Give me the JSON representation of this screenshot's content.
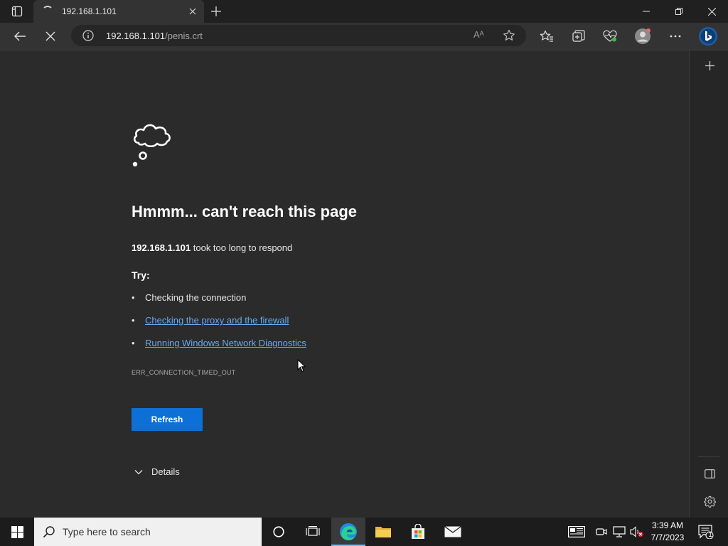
{
  "browser": {
    "tab_title": "192.168.1.101",
    "url_host": "192.168.1.101",
    "url_path": "/penis.crt",
    "read_aloud_label": "Aᴬ"
  },
  "page": {
    "heading": "Hmmm... can't reach this page",
    "host": "192.168.1.101",
    "message": " took too long to respond",
    "try_label": "Try:",
    "suggestions": [
      "Checking the connection",
      "Checking the proxy and the firewall",
      "Running Windows Network Diagnostics"
    ],
    "error_code": "ERR_CONNECTION_TIMED_OUT",
    "refresh_label": "Refresh",
    "details_label": "Details"
  },
  "taskbar": {
    "search_placeholder": "Type here to search",
    "time": "3:39 AM",
    "date": "7/7/2023",
    "notification_count": "1"
  },
  "colors": {
    "accent": "#0c70d6",
    "link": "#69a9ee",
    "page_bg": "#2b2b2b"
  },
  "icons": [
    "tab-actions-icon",
    "loading-spinner-icon",
    "close-icon",
    "plus-icon",
    "minimize-icon",
    "restore-icon",
    "back-arrow-icon",
    "stop-icon",
    "info-icon",
    "read-aloud-icon",
    "star-icon",
    "favorites-icon",
    "collections-icon",
    "heart-pulse-icon",
    "profile-icon",
    "more-icon",
    "bing-icon",
    "cloud-icon",
    "chevron-down-icon",
    "windows-logo-icon",
    "search-icon",
    "cortana-icon",
    "task-view-icon",
    "edge-icon",
    "folder-icon",
    "store-icon",
    "mail-icon"
  ]
}
